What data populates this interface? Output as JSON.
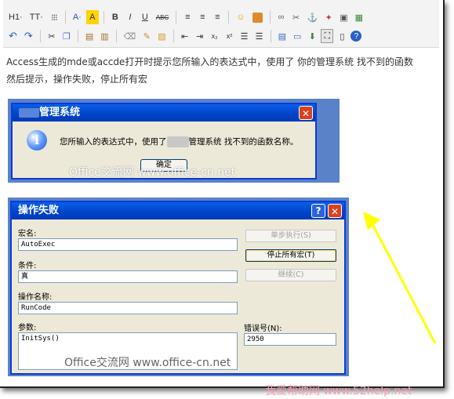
{
  "toolbar": {
    "row1": [
      "H1",
      "TT"
    ],
    "heading_label": "H1·",
    "fontsize_label": "TT·",
    "fontcolor_label": "A·",
    "bold_label": "B",
    "italic_label": "I",
    "underline_label": "U",
    "strike_label": "ABC"
  },
  "editor": {
    "line1": "Access生成的mde或accde打开时提示您所输入的表达式中，使用了 你的管理系统 找不到的函数",
    "line2": "然后提示，操作失败，停止所有宏"
  },
  "screenshot1": {
    "title": "管理系统",
    "message_prefix": "您所输入的表达式中，使用了",
    "message_suffix": "管理系统 找不到的函数名称。",
    "ok_button": "确定",
    "watermark": "Office交流网 www.office-cn.net"
  },
  "screenshot2": {
    "title": "操作失败",
    "macro_name_label": "宏名:",
    "macro_name_value": "AutoExec",
    "condition_label": "条件:",
    "condition_value": "真",
    "action_name_label": "操作名称:",
    "action_name_value": "RunCode",
    "arguments_label": "参数:",
    "arguments_value": "InitSys()",
    "error_label": "错误号(N):",
    "error_value": "2950",
    "step_button": "单步执行(S)",
    "stop_button": "停止所有宏(T)",
    "continue_button": "继续(C)",
    "watermark": "Office交流网 www.office-cn.net"
  },
  "footer": {
    "brand": "我爱帮助网 www.52help.net"
  },
  "colors": {
    "xp_title": "#0042c8",
    "xp_close": "#d8421c",
    "arrow": "#ffff00",
    "brand": "#f0a0b4"
  }
}
